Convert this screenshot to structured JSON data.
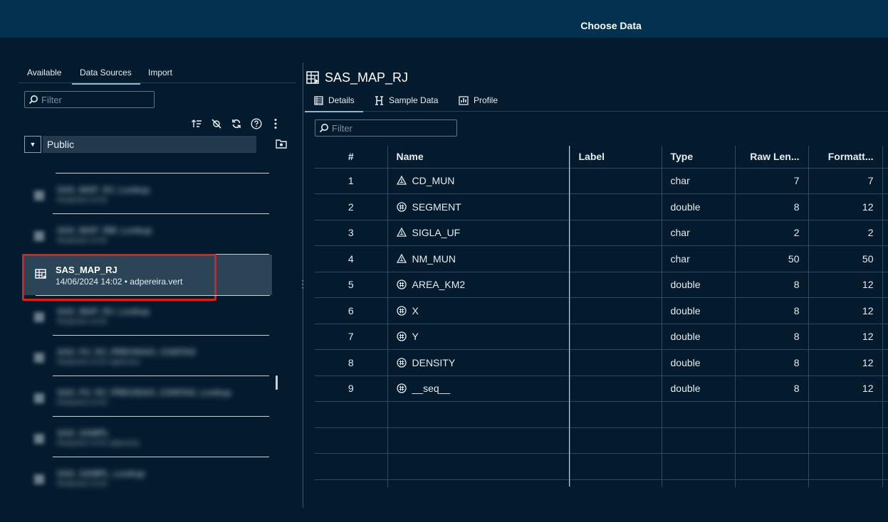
{
  "dialog": {
    "title": "Choose Data"
  },
  "left": {
    "tabs": [
      {
        "label": "Available"
      },
      {
        "label": "Data Sources"
      },
      {
        "label": "Import"
      }
    ],
    "filter_placeholder": "Filter",
    "library": {
      "selected": "Public"
    },
    "selected_item": {
      "name": "SAS_MAP_RJ",
      "meta": "14/06/2024 14:02 • adpereira.vert"
    },
    "blurred_items": [
      {
        "name": "SAS_MAP_RJ_Lookup",
        "meta": "Redacted 14:02"
      },
      {
        "name": "SAS_MAP_RM_Lookup",
        "meta": "Redacted 14:02"
      },
      {
        "name": "SAS_MAP_RJ_Lookup",
        "meta": "Redacted 14:02"
      },
      {
        "name": "SAS_FU_RJ_PREVISAO_CONTAS",
        "meta": "Redacted 14:02 adpereira"
      },
      {
        "name": "SAS_FU_RJ_PREVISAO_CONTAS_Lookup",
        "meta": "Redacted 14:02"
      },
      {
        "name": "SAS_SAMPL",
        "meta": "Redacted 14:02 adpereira"
      },
      {
        "name": "SAS_SAMPL_Lookup",
        "meta": "Redacted 14:02"
      }
    ]
  },
  "right": {
    "title": "SAS_MAP_RJ",
    "tabs": [
      {
        "label": "Details"
      },
      {
        "label": "Sample Data"
      },
      {
        "label": "Profile"
      }
    ],
    "filter_placeholder": "Filter",
    "columns": [
      "#",
      "Name",
      "Label",
      "Type",
      "Raw Len...",
      "Formatt..."
    ],
    "rows": [
      {
        "n": "1",
        "name": "CD_MUN",
        "kind": "char",
        "label": "",
        "type": "char",
        "raw": "7",
        "fmt": "7"
      },
      {
        "n": "2",
        "name": "SEGMENT",
        "kind": "num",
        "label": "",
        "type": "double",
        "raw": "8",
        "fmt": "12"
      },
      {
        "n": "3",
        "name": "SIGLA_UF",
        "kind": "char",
        "label": "",
        "type": "char",
        "raw": "2",
        "fmt": "2"
      },
      {
        "n": "4",
        "name": "NM_MUN",
        "kind": "char",
        "label": "",
        "type": "char",
        "raw": "50",
        "fmt": "50"
      },
      {
        "n": "5",
        "name": "AREA_KM2",
        "kind": "num",
        "label": "",
        "type": "double",
        "raw": "8",
        "fmt": "12"
      },
      {
        "n": "6",
        "name": "X",
        "kind": "num",
        "label": "",
        "type": "double",
        "raw": "8",
        "fmt": "12"
      },
      {
        "n": "7",
        "name": "Y",
        "kind": "num",
        "label": "",
        "type": "double",
        "raw": "8",
        "fmt": "12"
      },
      {
        "n": "8",
        "name": "DENSITY",
        "kind": "num",
        "label": "",
        "type": "double",
        "raw": "8",
        "fmt": "12"
      },
      {
        "n": "9",
        "name": "__seq__",
        "kind": "num",
        "label": "",
        "type": "double",
        "raw": "8",
        "fmt": "12"
      }
    ]
  }
}
